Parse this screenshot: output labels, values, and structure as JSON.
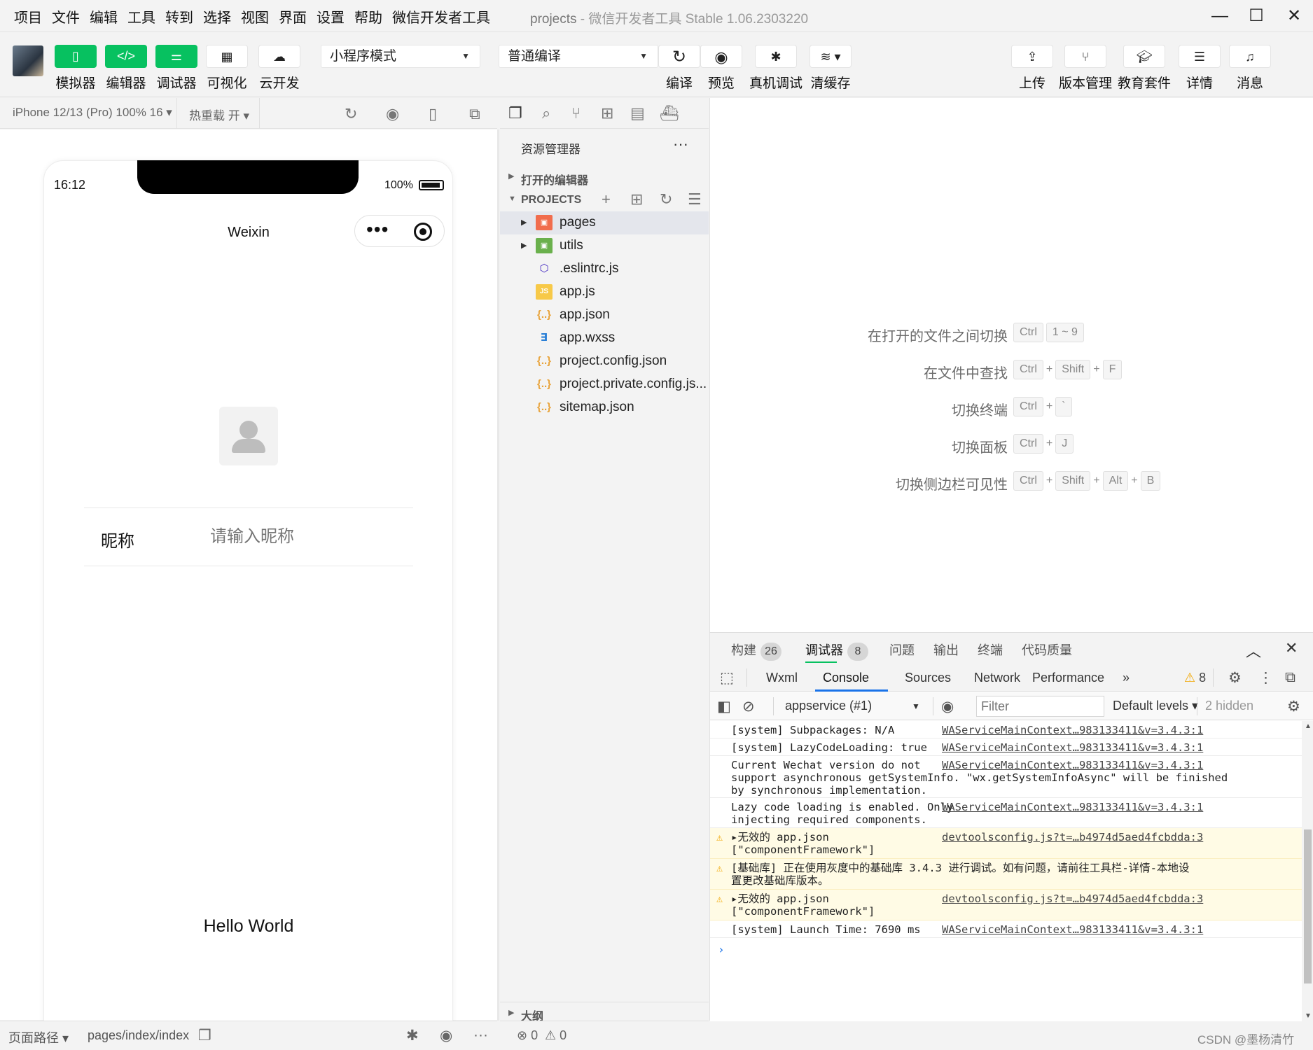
{
  "menubar": {
    "items": [
      "项目",
      "文件",
      "编辑",
      "工具",
      "转到",
      "选择",
      "视图",
      "界面",
      "设置",
      "帮助",
      "微信开发者工具"
    ],
    "title_project": "projects",
    "title_rest": " - 微信开发者工具 Stable 1.06.2303220",
    "minimize": "—",
    "maximize": "☐",
    "close": "✕"
  },
  "toolbar": {
    "simulator_label": "模拟器",
    "editor_label": "编辑器",
    "debugger_label": "调试器",
    "visual_label": "可视化",
    "cloud_label": "云开发",
    "mode_select": "小程序模式",
    "compile_select": "普通编译",
    "compile_label": "编译",
    "preview_label": "预览",
    "device_debug_label": "真机调试",
    "clear_cache_label": "清缓存",
    "upload_label": "上传",
    "version_label": "版本管理",
    "edu_label": "教育套件",
    "details_label": "详情",
    "messages_label": "消息"
  },
  "simulator": {
    "device": "iPhone 12/13 (Pro) 100% 16 ▾",
    "hot_reload": "热重载 开 ▾",
    "status_time": "16:12",
    "battery": "100%",
    "nav_title": "Weixin",
    "nickname_label": "昵称",
    "nickname_placeholder": "请输入昵称",
    "hello": "Hello World",
    "footer_path_label": "页面路径 ▾",
    "footer_page": "pages/index/index"
  },
  "explorer": {
    "title": "资源管理器",
    "more": "···",
    "open_editors": "打开的编辑器",
    "projects": "PROJECTS",
    "files": [
      {
        "name": "pages",
        "icon": "folder-red",
        "glyph": "▣"
      },
      {
        "name": "utils",
        "icon": "folder-green",
        "glyph": "▣"
      },
      {
        "name": ".eslintrc.js",
        "icon": "eslint-icon",
        "glyph": "⬡"
      },
      {
        "name": "app.js",
        "icon": "js-icon",
        "glyph": "JS"
      },
      {
        "name": "app.json",
        "icon": "json-icon",
        "glyph": "{..}"
      },
      {
        "name": "app.wxss",
        "icon": "css-icon",
        "glyph": "∃"
      },
      {
        "name": "project.config.json",
        "icon": "json-icon",
        "glyph": "{..}"
      },
      {
        "name": "project.private.config.js...",
        "icon": "json-icon",
        "glyph": "{..}"
      },
      {
        "name": "sitemap.json",
        "icon": "json-icon",
        "glyph": "{..}"
      }
    ],
    "outline": "大纲",
    "footer_errors": "⊗ 0",
    "footer_warnings": "⚠ 0"
  },
  "editor": {
    "shortcuts": [
      {
        "label": "在打开的文件之间切换",
        "keys": [
          "Ctrl",
          "1 ~ 9"
        ]
      },
      {
        "label": "在文件中查找",
        "keys": [
          "Ctrl",
          "Shift",
          "F"
        ]
      },
      {
        "label": "切换终端",
        "keys": [
          "Ctrl",
          "`"
        ]
      },
      {
        "label": "切换面板",
        "keys": [
          "Ctrl",
          "J"
        ]
      },
      {
        "label": "切换侧边栏可见性",
        "keys": [
          "Ctrl",
          "Shift",
          "Alt",
          "B"
        ]
      }
    ]
  },
  "panel": {
    "tabs": {
      "build": "构建",
      "build_count": "26",
      "debugger": "调试器",
      "debugger_count": "8",
      "problems": "问题",
      "output": "输出",
      "terminal": "终端",
      "quality": "代码质量"
    },
    "devtools": {
      "wxml": "Wxml",
      "console": "Console",
      "sources": "Sources",
      "network": "Network",
      "performance": "Performance",
      "more": "»",
      "warn_count": "8"
    },
    "filter": {
      "context": "appservice (#1)",
      "placeholder": "Filter",
      "levels": "Default levels ▾",
      "hidden": "2 hidden"
    },
    "logs": [
      {
        "msg": "[system] Subpackages: N/A",
        "src": "WAServiceMainContext…983133411&v=3.4.3:1"
      },
      {
        "msg": "[system] LazyCodeLoading: true",
        "src": "WAServiceMainContext…983133411&v=3.4.3:1"
      },
      {
        "msg": "Current Wechat version do not\nsupport asynchronous getSystemInfo. \"wx.getSystemInfoAsync\" will be finished\nby synchronous implementation.",
        "src": "WAServiceMainContext…983133411&v=3.4.3:1"
      },
      {
        "msg": "Lazy code loading is enabled. Only\ninjecting required components.",
        "src": "WAServiceMainContext…983133411&v=3.4.3:1"
      },
      {
        "msg": "▸无效的 app.json\n[\"componentFramework\"]",
        "src": "devtoolsconfig.js?t=…b4974d5aed4fcbdda:3"
      },
      {
        "msg": "[基础库] 正在使用灰度中的基础库 3.4.3 进行调试。如有问题，请前往工具栏-详情-本地设\n置更改基础库版本。",
        "src": ""
      },
      {
        "msg": "▸无效的 app.json\n[\"componentFramework\"]",
        "src": "devtoolsconfig.js?t=…b4974d5aed4fcbdda:3"
      },
      {
        "msg": "[system] Launch Time: 7690 ms",
        "src": "WAServiceMainContext…983133411&v=3.4.3:1"
      }
    ],
    "prompt": "›"
  },
  "watermark": "CSDN @墨杨清竹",
  "colors": {
    "brand_green": "#07c160",
    "warn_yellow": "#f1a600",
    "link_blue": "#1a73e8"
  }
}
